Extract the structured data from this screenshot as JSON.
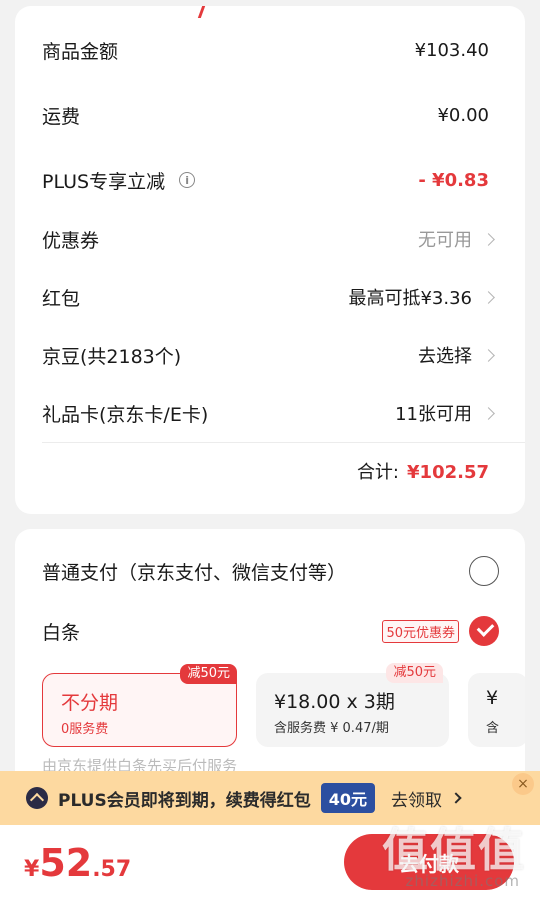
{
  "summary": {
    "goods_amount_label": "商品金额",
    "goods_amount_value": "¥103.40",
    "shipping_label": "运费",
    "shipping_value": "¥0.00",
    "plus_discount_label": "PLUS专享立减",
    "plus_discount_value": "- ¥0.83",
    "coupon_label": "优惠券",
    "coupon_value": "无可用",
    "redpacket_label": "红包",
    "redpacket_value": "最高可抵¥3.36",
    "jingdou_label": "京豆(共2183个)",
    "jingdou_value": "去选择",
    "giftcard_label": "礼品卡(京东卡/E卡)",
    "giftcard_value": "11张可用",
    "total_label": "合计:",
    "total_value": "¥102.57"
  },
  "payment": {
    "normal_pay_label": "普通支付（京东支付、微信支付等）",
    "baitiao_label": "白条",
    "baitiao_coupon_tag": "50元优惠券",
    "plans": [
      {
        "title": "不分期",
        "sub": "0服务费",
        "badge": "减50元",
        "selected": true
      },
      {
        "title": "¥18.00 x 3期",
        "sub": "含服务费 ¥ 0.47/期",
        "badge": "减50元",
        "selected": false
      },
      {
        "title": "¥",
        "sub": "含",
        "badge": "",
        "selected": false
      }
    ],
    "provider_note": "由京东提供白条先买后付服务"
  },
  "plus_banner": {
    "text": "PLUS会员即将到期，续费得红包",
    "amount": "40元",
    "link": "去领取",
    "close": "×"
  },
  "bottom": {
    "currency": "¥",
    "price_int": "52",
    "price_dec": ".57",
    "pay_button": "去付款"
  },
  "watermark": {
    "text": "值值值",
    "url": "zhizhizhi.com"
  },
  "colors": {
    "accent_red": "#e4393c",
    "plus_gold": "#fdd9a0",
    "plus_blue": "#2c4fa0"
  }
}
